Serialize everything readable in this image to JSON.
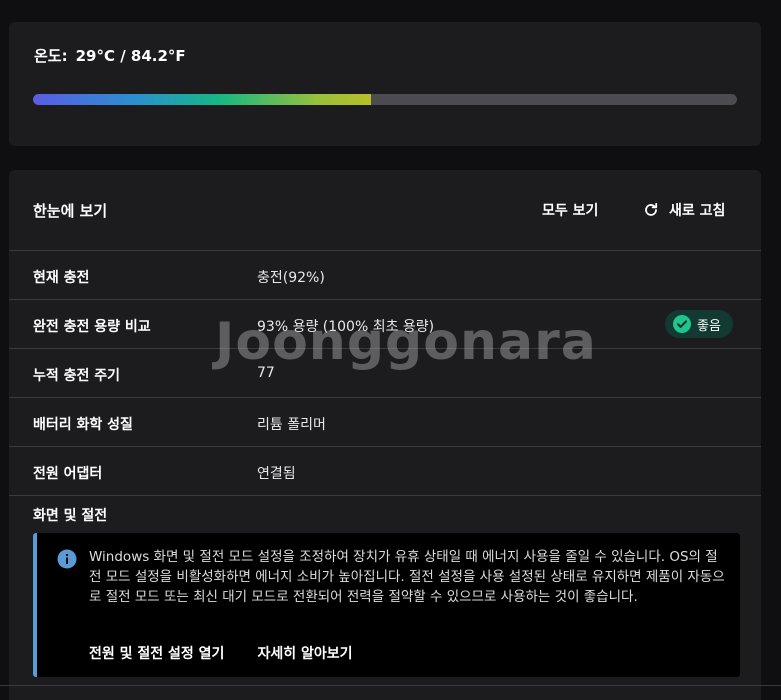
{
  "temperature": {
    "label": "온도:",
    "value": "29°C / 84.2°F",
    "level": 0.48
  },
  "overview": {
    "title": "한눈에 보기",
    "view_all": "모두 보기",
    "refresh": "새로 고침",
    "rows": [
      {
        "key": "현재 충전",
        "value": "충전(92%)"
      },
      {
        "key": "완전 충전 용량 비교",
        "value": "93% 용량 (100% 최초 용량)",
        "badge": "좋음"
      },
      {
        "key": "누적 충전 주기",
        "value": "77"
      },
      {
        "key": "배터리 화학 성질",
        "value": "리튬 폴리머"
      },
      {
        "key": "전원 어댑터",
        "value": "연결됨"
      }
    ],
    "screen_power_title": "화면 및 절전",
    "info_text": "Windows 화면 및 절전 모드 설정을 조정하여 장치가 유휴 상태일 때 에너지 사용을 줄일 수 있습니다. OS의 절전 모드 설정을 비활성화하면 에너지 소비가 높아집니다. 절전 설정을 사용 설정된 상태로 유지하면 제품이 자동으로 절전 모드 또는 최신 대기 모드로 전환되어 전력을 절약할 수 있으므로 사용하는 것이 좋습니다.",
    "link_open_settings": "전원 및 절전 설정 열기",
    "link_learn_more": "자세히 알아보기"
  },
  "watermark": "Joonggonara",
  "colors": {
    "accent_blue": "#5b9bd5",
    "good_green": "#1ec58f",
    "card_bg": "#1c1c1f"
  }
}
